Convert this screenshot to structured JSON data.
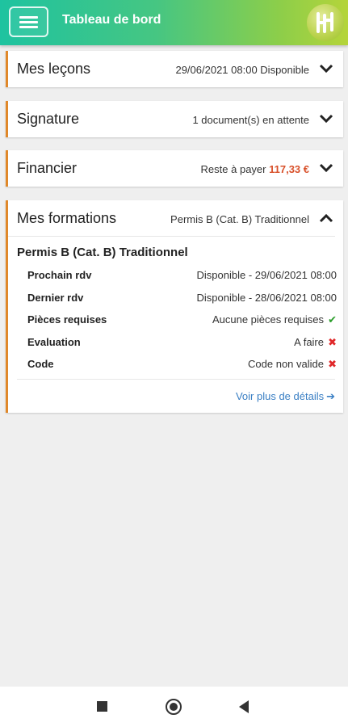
{
  "header": {
    "title": "Tableau de bord",
    "menu_icon": "hamburger-icon",
    "logo_icon": "brand-logo"
  },
  "cards": {
    "lecons": {
      "title": "Mes leçons",
      "info": "29/06/2021 08:00 Disponible",
      "expanded": false
    },
    "signature": {
      "title": "Signature",
      "info": "1 document(s) en attente",
      "expanded": false
    },
    "financier": {
      "title": "Financier",
      "info_label": "Reste à payer",
      "amount": "117,33 €",
      "expanded": false
    },
    "formations": {
      "title": "Mes formations",
      "info": "Permis B (Cat. B) Traditionnel",
      "expanded": true,
      "formation_title": "Permis B (Cat. B) Traditionnel",
      "rows": [
        {
          "label": "Prochain rdv",
          "value": "Disponible - 29/06/2021 08:00"
        },
        {
          "label": "Dernier rdv",
          "value": "Disponible - 28/06/2021 08:00"
        },
        {
          "label": "Pièces requises",
          "value": "Aucune pièces requises",
          "status": "check-icon"
        },
        {
          "label": "Evaluation",
          "value": "A faire",
          "status": "cross-icon"
        },
        {
          "label": "Code",
          "value": "Code non valide",
          "status": "cross-icon"
        }
      ],
      "details_link": "Voir plus de détails"
    }
  },
  "colors": {
    "accent_border": "#e0882a",
    "amount": "#d8502a",
    "link": "#3a7fc4",
    "ok": "#2a9d2a",
    "ko": "#e0282a"
  },
  "navbar": {
    "icons": [
      "recent-apps-icon",
      "home-icon",
      "back-icon"
    ]
  }
}
